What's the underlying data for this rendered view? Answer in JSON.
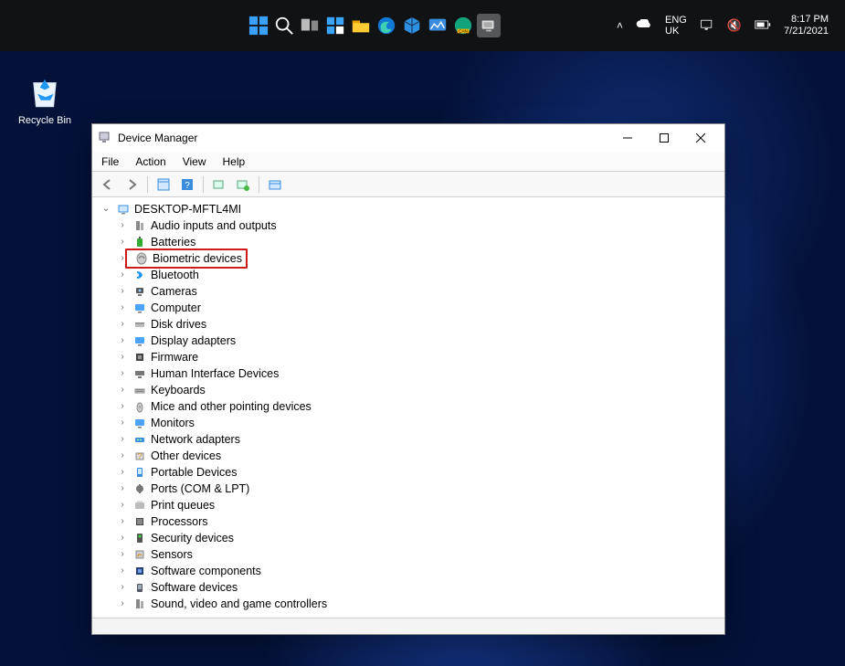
{
  "taskbar": {
    "lang_top": "ENG",
    "lang_bottom": "UK",
    "time": "8:17 PM",
    "date": "7/21/2021"
  },
  "desktop": {
    "recycle_bin_label": "Recycle Bin"
  },
  "window": {
    "title": "Device Manager",
    "menu": {
      "file": "File",
      "action": "Action",
      "view": "View",
      "help": "Help"
    },
    "root": "DESKTOP-MFTL4MI",
    "categories": [
      "Audio inputs and outputs",
      "Batteries",
      "Biometric devices",
      "Bluetooth",
      "Cameras",
      "Computer",
      "Disk drives",
      "Display adapters",
      "Firmware",
      "Human Interface Devices",
      "Keyboards",
      "Mice and other pointing devices",
      "Monitors",
      "Network adapters",
      "Other devices",
      "Portable Devices",
      "Ports (COM & LPT)",
      "Print queues",
      "Processors",
      "Security devices",
      "Sensors",
      "Software components",
      "Software devices",
      "Sound, video and game controllers"
    ],
    "highlight_index": 2
  }
}
